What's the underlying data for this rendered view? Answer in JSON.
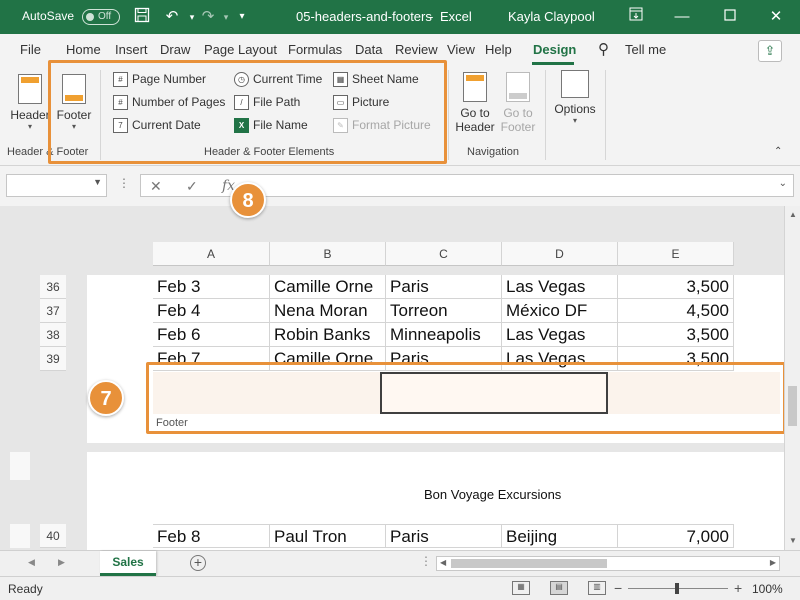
{
  "titlebar": {
    "autosave_label": "AutoSave",
    "autosave_state": "Off",
    "filename": "05-headers-and-footers",
    "separator": "-",
    "app_name": "Excel",
    "user": "Kayla Claypool"
  },
  "tabs": [
    "File",
    "Home",
    "Insert",
    "Draw",
    "Page Layout",
    "Formulas",
    "Data",
    "Review",
    "View",
    "Help",
    "Design"
  ],
  "active_tab": "Design",
  "tell_me": "Tell me",
  "ribbon": {
    "header_footer_group": {
      "label": "Header & Footer",
      "header": "Header",
      "footer": "Footer"
    },
    "elements_group": {
      "label": "Header & Footer Elements",
      "page_number": "Page Number",
      "number_of_pages": "Number of Pages",
      "current_date": "Current Date",
      "current_time": "Current Time",
      "file_path": "File Path",
      "file_name": "File Name",
      "sheet_name": "Sheet Name",
      "picture": "Picture",
      "format_picture": "Format Picture"
    },
    "navigation_group": {
      "label": "Navigation",
      "goto_header_l1": "Go to",
      "goto_header_l2": "Header",
      "goto_footer_l1": "Go to",
      "goto_footer_l2": "Footer"
    },
    "options_group": {
      "options": "Options"
    }
  },
  "callouts": {
    "seven": "7",
    "eight": "8"
  },
  "formula_bar": {
    "name_box": "",
    "formula": ""
  },
  "columns": [
    "A",
    "B",
    "C",
    "D",
    "E"
  ],
  "rows": [
    {
      "num": "36",
      "date": "Feb 3",
      "name": "Camille Orne",
      "from": "Paris",
      "to": "Las Vegas",
      "amount": "3,500"
    },
    {
      "num": "37",
      "date": "Feb 4",
      "name": "Nena Moran",
      "from": "Torreon",
      "to": "México DF",
      "amount": "4,500"
    },
    {
      "num": "38",
      "date": "Feb 6",
      "name": "Robin Banks",
      "from": "Minneapolis",
      "to": "Las Vegas",
      "amount": "3,500"
    },
    {
      "num": "39",
      "date": "Feb 7",
      "name": "Camille Orne",
      "from": "Paris",
      "to": "Las Vegas",
      "amount": "3,500"
    }
  ],
  "footer_label": "Footer",
  "page2": {
    "header_text": "Bon Voyage Excursions",
    "row": {
      "num": "40",
      "date": "Feb 8",
      "name": "Paul Tron",
      "from": "Paris",
      "to": "Beijing",
      "amount": "7,000"
    }
  },
  "sheet_tab": "Sales",
  "status": "Ready",
  "zoom": "100%",
  "colors": {
    "excel_green": "#217346",
    "callout_orange": "#e8913a"
  }
}
